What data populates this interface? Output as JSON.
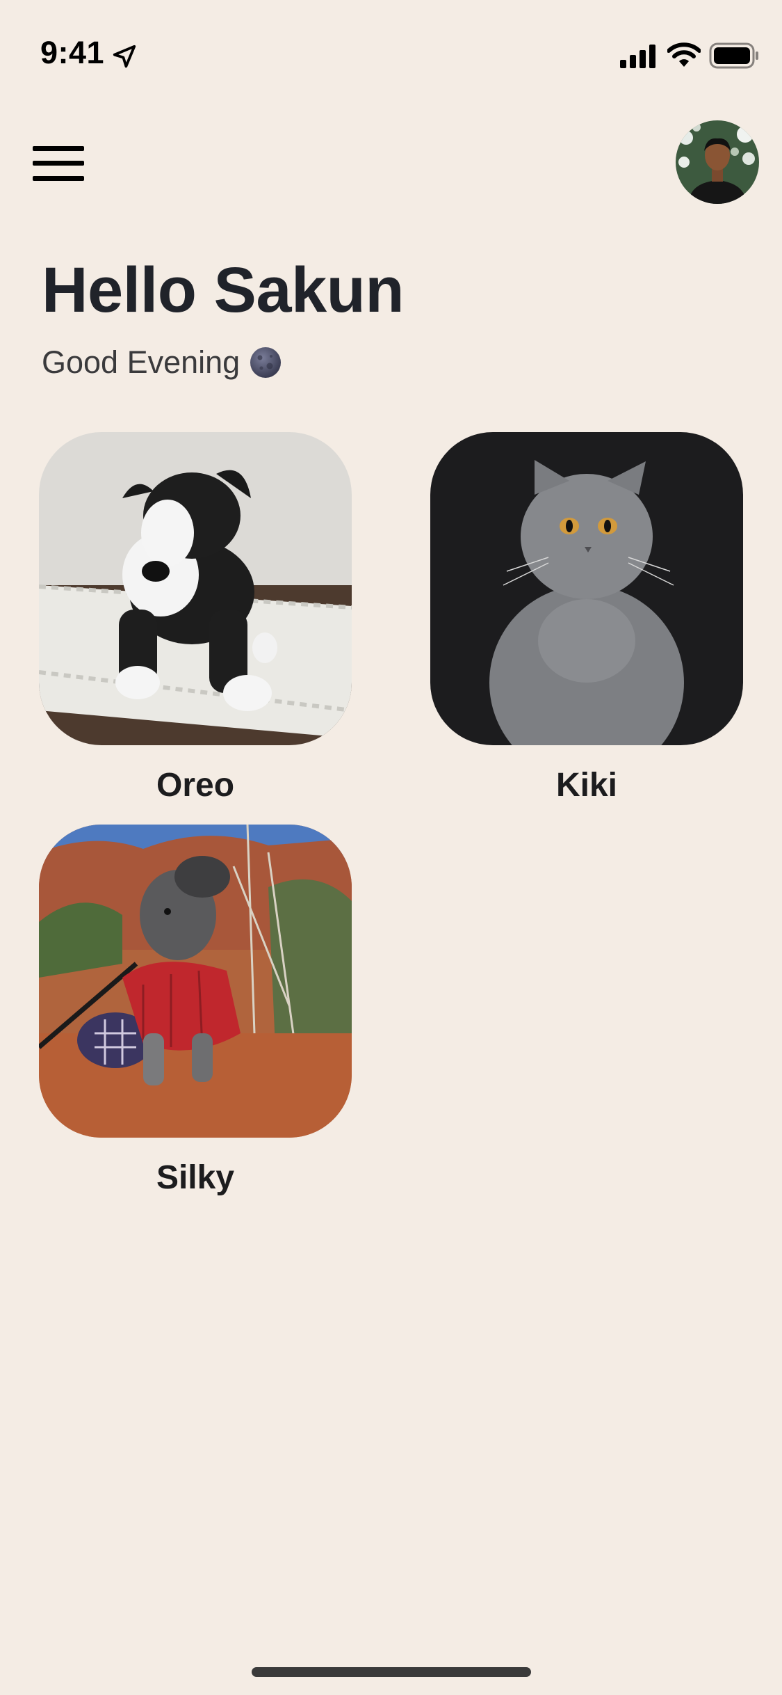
{
  "status_bar": {
    "time": "9:41",
    "icons": [
      "location-arrow-icon",
      "cellular-signal-icon",
      "wifi-icon",
      "battery-icon"
    ]
  },
  "header": {
    "menu_icon": "hamburger-menu-icon",
    "avatar_alt": "profile avatar"
  },
  "greeting": {
    "title": "Hello Sakun",
    "subtitle": "Good Evening",
    "subtitle_icon": "new-moon-icon"
  },
  "pets": [
    {
      "name": "Oreo"
    },
    {
      "name": "Kiki"
    },
    {
      "name": "Silky"
    }
  ],
  "colors": {
    "background": "#f4ece4",
    "text": "#1c1c1e",
    "title": "#20232a"
  }
}
